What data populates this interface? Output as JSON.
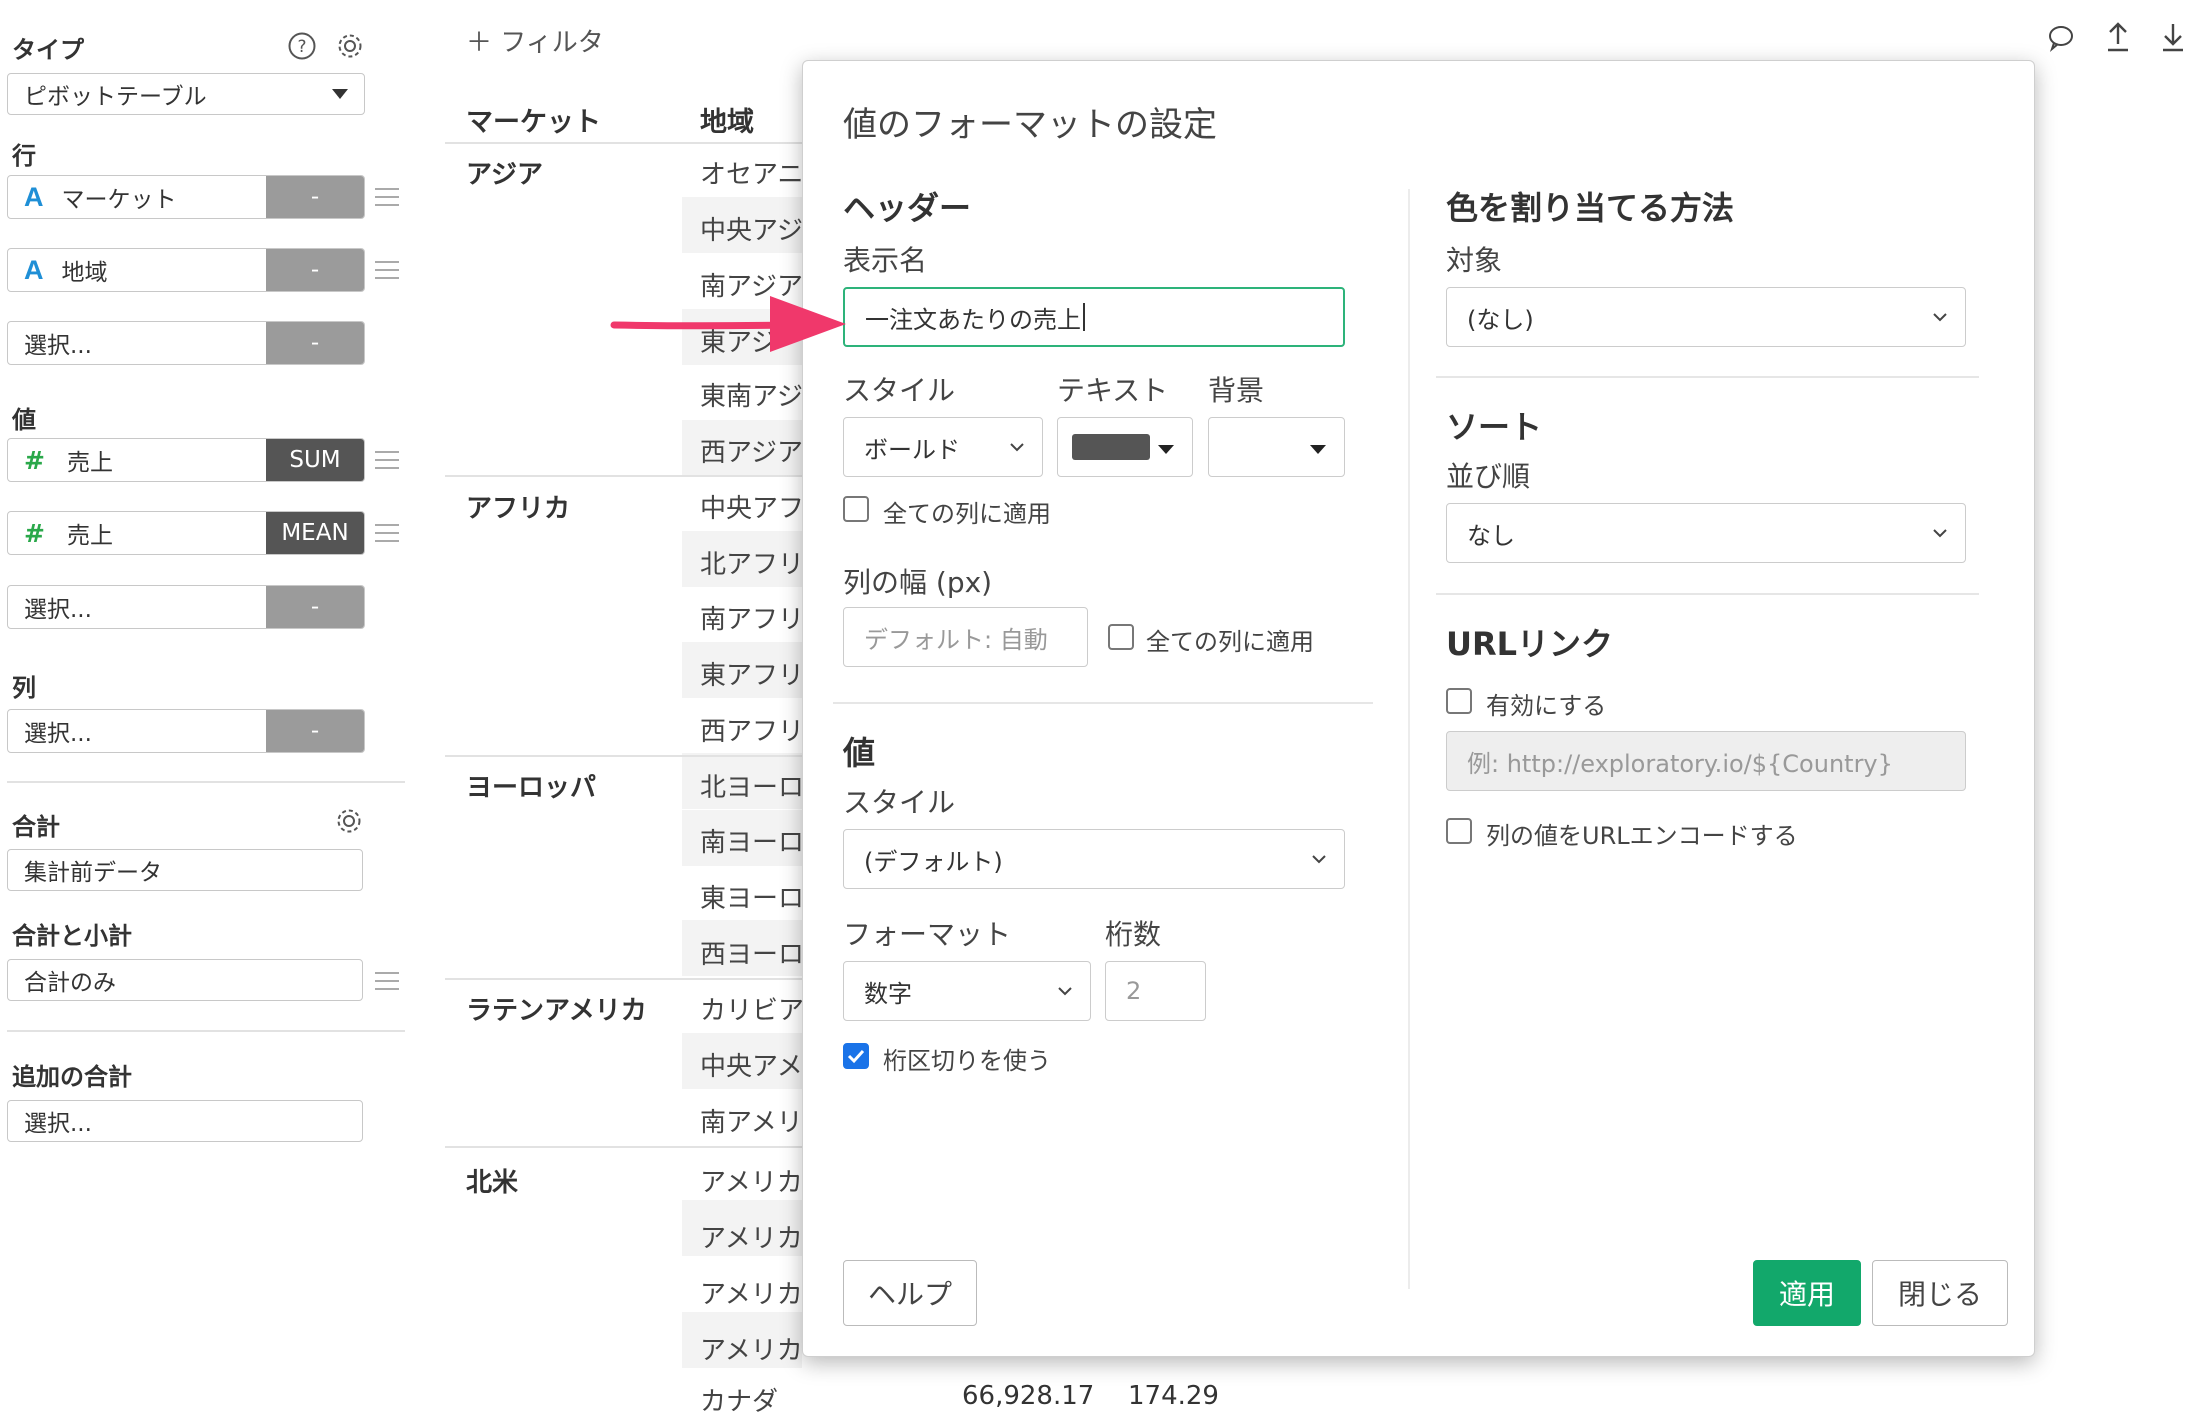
{
  "left_panel": {
    "type_label": "タイプ",
    "type_value": "ピボットテーブル",
    "rows_label": "行",
    "rows": [
      {
        "type": "A",
        "name": "マーケット",
        "action": "-"
      },
      {
        "type": "A",
        "name": "地域",
        "action": "-"
      },
      {
        "name": "選択...",
        "action": "-"
      }
    ],
    "values_label": "値",
    "values": [
      {
        "type": "#",
        "name": "売上",
        "action": "SUM"
      },
      {
        "type": "#",
        "name": "売上",
        "action": "MEAN"
      },
      {
        "name": "選択...",
        "action": "-"
      }
    ],
    "columns_label": "列",
    "columns": [
      {
        "name": "選択...",
        "action": "-"
      }
    ],
    "total_label": "合計",
    "total_value": "集計前データ",
    "subtotal_label": "合計と小計",
    "subtotal_value": "合計のみ",
    "extra_total_label": "追加の合計",
    "extra_total_value": "選択..."
  },
  "toolbar": {
    "filter_label": "＋ フィルタ"
  },
  "table": {
    "headers": [
      "マーケット",
      "地域"
    ],
    "markets": [
      "アジア",
      "アフリカ",
      "ヨーロッパ",
      "ラテンアメリカ",
      "北米"
    ],
    "regions": [
      "オセアニ",
      "中央アジ",
      "南アジア",
      "東アジ",
      "東南アジ",
      "西アジア",
      "中央アフ",
      "北アフリ",
      "南アフリ",
      "東アフリ",
      "西アフリ",
      "北ヨーロ",
      "南ヨーロ",
      "東ヨーロ",
      "西ヨーロ",
      "カリビア",
      "中央アメ",
      "南アメリ",
      "アメリカ",
      "アメリカ",
      "アメリカ",
      "アメリカ",
      "カナダ"
    ],
    "last_row": {
      "value1": "66,928.17",
      "value2": "174.29"
    }
  },
  "modal": {
    "title": "値のフォーマットの設定",
    "header_section": "ヘッダー",
    "display_name_label": "表示名",
    "display_name_value": "一注文あたりの売上",
    "style_label": "スタイル",
    "text_label": "テキスト",
    "bg_label": "背景",
    "style_value": "ボールド",
    "text_color": "#555555",
    "apply_all_cols_1": "全ての列に適用",
    "col_width_label": "列の幅 (px)",
    "col_width_placeholder": "デフォルト: 自動",
    "apply_all_cols_2": "全ての列に適用",
    "value_section": "値",
    "value_style_label": "スタイル",
    "value_style_value": "(デフォルト)",
    "format_label": "フォーマット",
    "digits_label": "桁数",
    "format_value": "数字",
    "digits_placeholder": "2",
    "use_separator_label": "桁区切りを使う",
    "use_separator_checked": true,
    "color_section": "色を割り当てる方法",
    "target_label": "対象",
    "target_value": "(なし)",
    "sort_section": "ソート",
    "sort_order_label": "並び順",
    "sort_order_value": "なし",
    "url_section": "URLリンク",
    "enable_label": "有効にする",
    "url_placeholder": "例: http://exploratory.io/${Country}",
    "url_encode_label": "列の値をURLエンコードする",
    "help_button": "ヘルプ",
    "apply_button": "適用",
    "close_button": "閉じる"
  },
  "colors": {
    "accent": "#12a86b",
    "annotation_arrow": "#f0386b",
    "checkbox": "#1a73e8"
  }
}
